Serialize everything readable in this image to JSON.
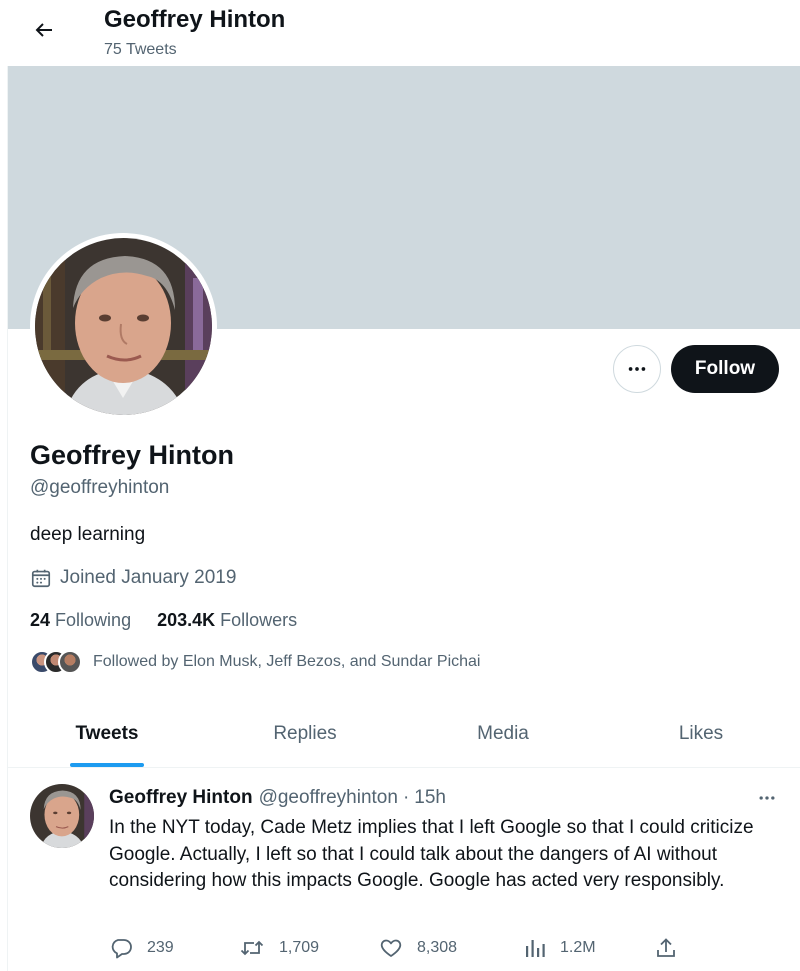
{
  "header": {
    "name": "Geoffrey Hinton",
    "tweet_count": "75 Tweets",
    "back_icon": "arrow-left-icon"
  },
  "profile": {
    "name": "Geoffrey Hinton",
    "handle": "@geoffreyhinton",
    "bio": "deep learning",
    "joined": "Joined January 2019",
    "following_count": "24",
    "following_label": "Following",
    "followers_count": "203.4K",
    "followers_label": "Followers",
    "followed_by": "Followed by Elon Musk, Jeff Bezos, and Sundar Pichai"
  },
  "buttons": {
    "follow": "Follow",
    "more_icon": "more-horizontal-icon"
  },
  "tabs": [
    {
      "label": "Tweets",
      "active": true
    },
    {
      "label": "Replies",
      "active": false
    },
    {
      "label": "Media",
      "active": false
    },
    {
      "label": "Likes",
      "active": false
    }
  ],
  "tweet": {
    "author": "Geoffrey Hinton",
    "handle": "@geoffreyhinton",
    "separator": "·",
    "time": "15h",
    "text": "In the NYT today, Cade Metz implies that I left Google so that I could criticize Google. Actually, I left so that I could talk about the dangers of AI without considering how this impacts Google. Google has acted very responsibly.",
    "replies": "239",
    "retweets": "1,709",
    "likes": "8,308",
    "views": "1.2M"
  },
  "colors": {
    "accent": "#1d9bf0",
    "banner": "#cfd9de",
    "text_primary": "#0f1419",
    "text_secondary": "#536471",
    "follow_button": "#0f1419"
  }
}
